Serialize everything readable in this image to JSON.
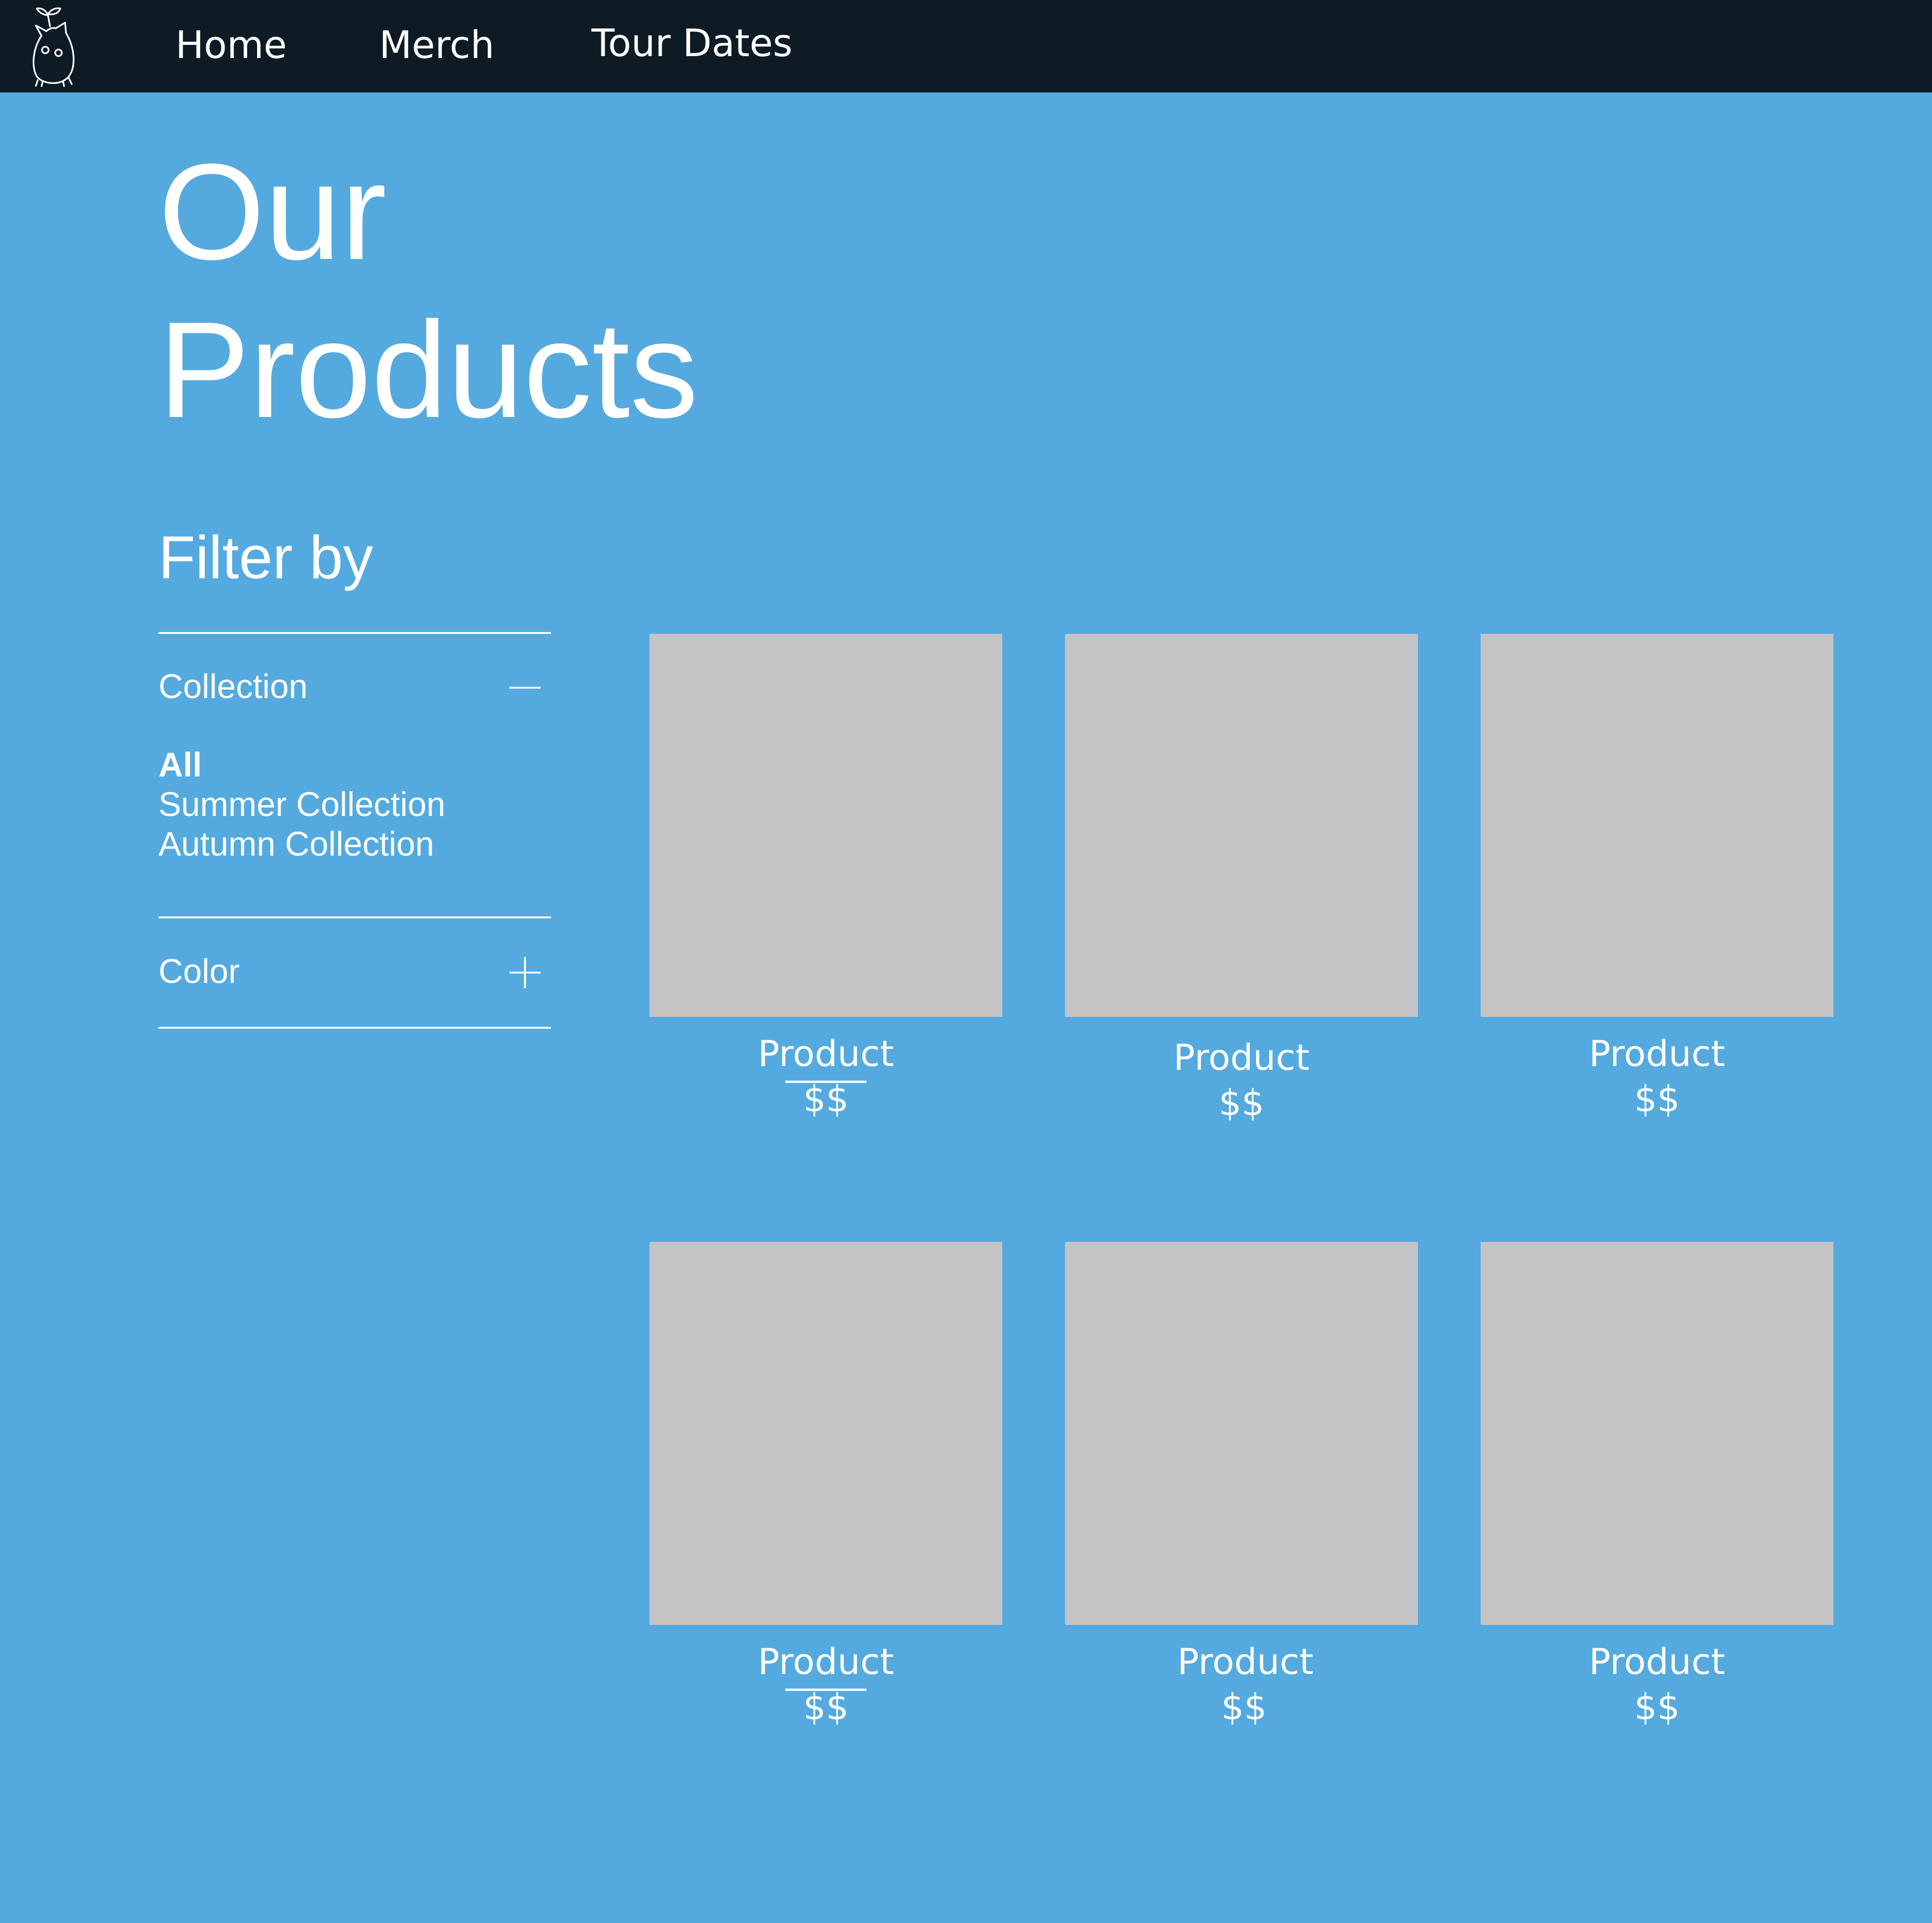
{
  "colors": {
    "background": "#54AADF",
    "navbar": "#0E1B25",
    "text": "#FFFFFF",
    "image_placeholder": "#C4C4C4"
  },
  "navbar": {
    "logo_icon": "sprout-creature-logo-icon",
    "links": [
      {
        "label": "Home"
      },
      {
        "label": "Merch"
      },
      {
        "label": "Tour Dates"
      }
    ]
  },
  "page": {
    "title_line_1": "Our",
    "title_line_2": "Products"
  },
  "filters": {
    "heading": "Filter by",
    "collection": {
      "label": "Collection",
      "toggle_icon": "minus-icon",
      "expanded": true,
      "options": [
        "All",
        "Summer Collection",
        "Autumn Collection"
      ],
      "selected": "All"
    },
    "color": {
      "label": "Color",
      "toggle_icon": "plus-icon",
      "expanded": false
    }
  },
  "products": [
    {
      "name": "Product",
      "price": "$$",
      "underlined": true
    },
    {
      "name": "Product",
      "price": "$$",
      "underlined": false
    },
    {
      "name": "Product",
      "price": "$$",
      "underlined": false
    },
    {
      "name": "Product",
      "price": "$$",
      "underlined": true
    },
    {
      "name": "Product",
      "price": "$$",
      "underlined": false
    },
    {
      "name": "Product",
      "price": "$$",
      "underlined": false
    }
  ]
}
